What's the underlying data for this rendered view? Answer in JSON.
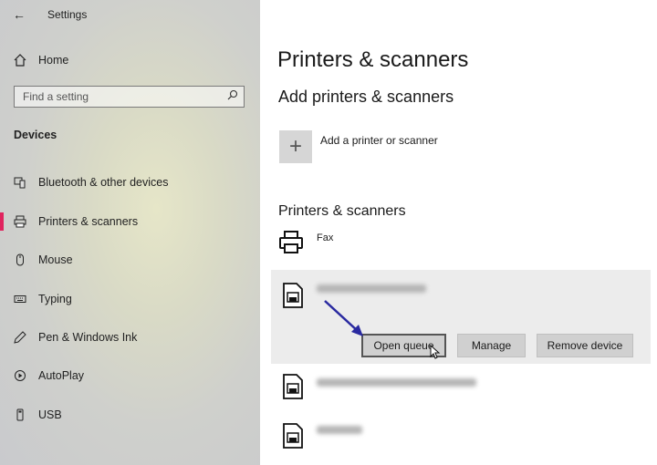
{
  "window": {
    "title": "Settings"
  },
  "sidebar": {
    "home_label": "Home",
    "search_placeholder": "Find a setting",
    "section": "Devices",
    "items": [
      {
        "label": "Bluetooth & other devices",
        "icon": "bluetooth-devices-icon"
      },
      {
        "label": "Printers & scanners",
        "icon": "printer-icon",
        "active": true
      },
      {
        "label": "Mouse",
        "icon": "mouse-icon"
      },
      {
        "label": "Typing",
        "icon": "keyboard-icon"
      },
      {
        "label": "Pen & Windows Ink",
        "icon": "pen-icon"
      },
      {
        "label": "AutoPlay",
        "icon": "autoplay-icon"
      },
      {
        "label": "USB",
        "icon": "usb-icon"
      }
    ]
  },
  "main": {
    "title": "Printers & scanners",
    "add_section": "Add printers & scanners",
    "add_label": "Add a printer or scanner",
    "list_section": "Printers & scanners",
    "printers": [
      {
        "name": "Fax"
      }
    ],
    "buttons": {
      "open_queue": "Open queue",
      "manage": "Manage",
      "remove": "Remove device"
    }
  },
  "colors": {
    "accent": "#e0245e",
    "arrow": "#2a2aa0"
  }
}
